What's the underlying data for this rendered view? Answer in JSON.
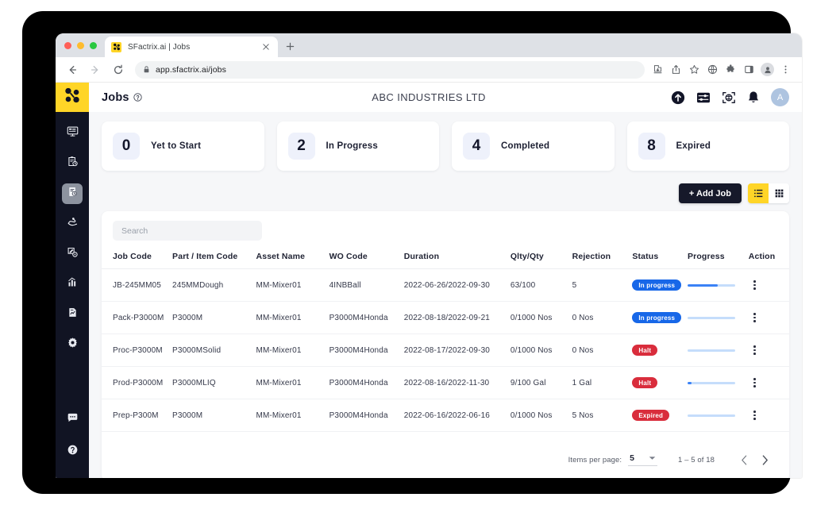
{
  "browser": {
    "tab": {
      "title": "SFactrix.ai | Jobs",
      "favicon_icon": "sfactrix-logo-icon",
      "close_icon": "close-icon"
    },
    "new_tab_icon": "plus-icon",
    "back_icon": "back-arrow-icon",
    "forward_icon": "forward-arrow-icon",
    "reload_icon": "reload-icon",
    "lock_icon": "lock-icon",
    "url": "app.sfactrix.ai/jobs",
    "toolbar_icons": [
      "install-icon",
      "share-icon",
      "bookmark-star-icon",
      "globe-icon",
      "extensions-puzzle-icon",
      "side-panel-icon",
      "profile-avatar-icon",
      "chrome-menu-icon"
    ],
    "window_controls": [
      "close",
      "minimize",
      "maximize"
    ]
  },
  "sidebar": {
    "logo_icon": "sfactrix-logo-icon",
    "items": [
      {
        "name": "dashboard",
        "icon": "monitor-dashboard-icon",
        "active": false
      },
      {
        "name": "schedule",
        "icon": "clipboard-clock-icon",
        "active": false
      },
      {
        "name": "jobs",
        "icon": "jobs-clipboard-icon",
        "active": true
      },
      {
        "name": "maintenance",
        "icon": "hand-tool-icon",
        "active": false
      },
      {
        "name": "configuration",
        "icon": "edit-gear-icon",
        "active": false
      },
      {
        "name": "analytics",
        "icon": "bar-chart-icon",
        "active": false
      },
      {
        "name": "reports",
        "icon": "report-document-icon",
        "active": false
      },
      {
        "name": "settings",
        "icon": "gear-icon",
        "active": false
      }
    ],
    "bottom_items": [
      {
        "name": "chat",
        "icon": "chat-bubble-icon"
      },
      {
        "name": "help",
        "icon": "help-circle-icon"
      }
    ]
  },
  "header": {
    "title": "Jobs",
    "help_icon": "help-circle-icon",
    "org_name": "ABC INDUSTRIES LTD",
    "icons": [
      {
        "name": "upload",
        "icon": "upload-circle-icon"
      },
      {
        "name": "filters",
        "icon": "sliders-icon"
      },
      {
        "name": "scan",
        "icon": "scan-qr-icon"
      },
      {
        "name": "notifications",
        "icon": "bell-icon"
      }
    ],
    "avatar_initial": "A"
  },
  "stats": [
    {
      "count": "0",
      "label": "Yet to Start"
    },
    {
      "count": "2",
      "label": "In Progress"
    },
    {
      "count": "4",
      "label": "Completed"
    },
    {
      "count": "8",
      "label": "Expired"
    }
  ],
  "toolbar": {
    "add_job_label": "+ Add Job",
    "list_view_icon": "list-view-icon",
    "grid_view_icon": "grid-view-icon",
    "active_view": "list"
  },
  "search": {
    "placeholder": "Search",
    "value": ""
  },
  "table": {
    "columns": [
      "Job Code",
      "Part / Item Code",
      "Asset Name",
      "WO Code",
      "Duration",
      "Qlty/Qty",
      "Rejection",
      "Status",
      "Progress",
      "Action"
    ],
    "rows": [
      {
        "job_code": "JB-245MM05",
        "part_code": "245MMDough",
        "asset_name": "MM-Mixer01",
        "wo_code": "4INBBall",
        "duration": "2022-06-26/2022-09-30",
        "qty": "63/100",
        "rejection": "5",
        "status": "In progress",
        "status_type": "progress",
        "progress": 63
      },
      {
        "job_code": "Pack-P3000M",
        "part_code": "P3000M",
        "asset_name": "MM-Mixer01",
        "wo_code": "P3000M4Honda",
        "duration": "2022-08-18/2022-09-21",
        "qty": "0/1000 Nos",
        "rejection": "0 Nos",
        "status": "In progress",
        "status_type": "progress",
        "progress": 0
      },
      {
        "job_code": "Proc-P3000M",
        "part_code": "P3000MSolid",
        "asset_name": "MM-Mixer01",
        "wo_code": "P3000M4Honda",
        "duration": "2022-08-17/2022-09-30",
        "qty": "0/1000 Nos",
        "rejection": "0 Nos",
        "status": "Halt",
        "status_type": "halt",
        "progress": 0
      },
      {
        "job_code": "Prod-P3000M",
        "part_code": "P3000MLIQ",
        "asset_name": "MM-Mixer01",
        "wo_code": "P3000M4Honda",
        "duration": "2022-08-16/2022-11-30",
        "qty": "9/100 Gal",
        "rejection": "1 Gal",
        "status": "Halt",
        "status_type": "halt",
        "progress": 9
      },
      {
        "job_code": "Prep-P300M",
        "part_code": "P3000M",
        "asset_name": "MM-Mixer01",
        "wo_code": "P3000M4Honda",
        "duration": "2022-06-16/2022-06-16",
        "qty": "0/1000 Nos",
        "rejection": "5 Nos",
        "status": "Expired",
        "status_type": "expired",
        "progress": 0
      }
    ],
    "action_icon": "kebab-menu-icon"
  },
  "pagination": {
    "items_per_page_label": "Items per page:",
    "items_per_page_value": "5",
    "range_label": "1 – 5 of 18",
    "prev_icon": "chevron-left-icon",
    "next_icon": "chevron-right-icon"
  },
  "colors": {
    "brand_yellow": "#ffd527",
    "sidebar_dark": "#111423",
    "status_progress": "#1767e8",
    "status_halt": "#d92d3c",
    "progress_fill": "#3b82f6"
  }
}
